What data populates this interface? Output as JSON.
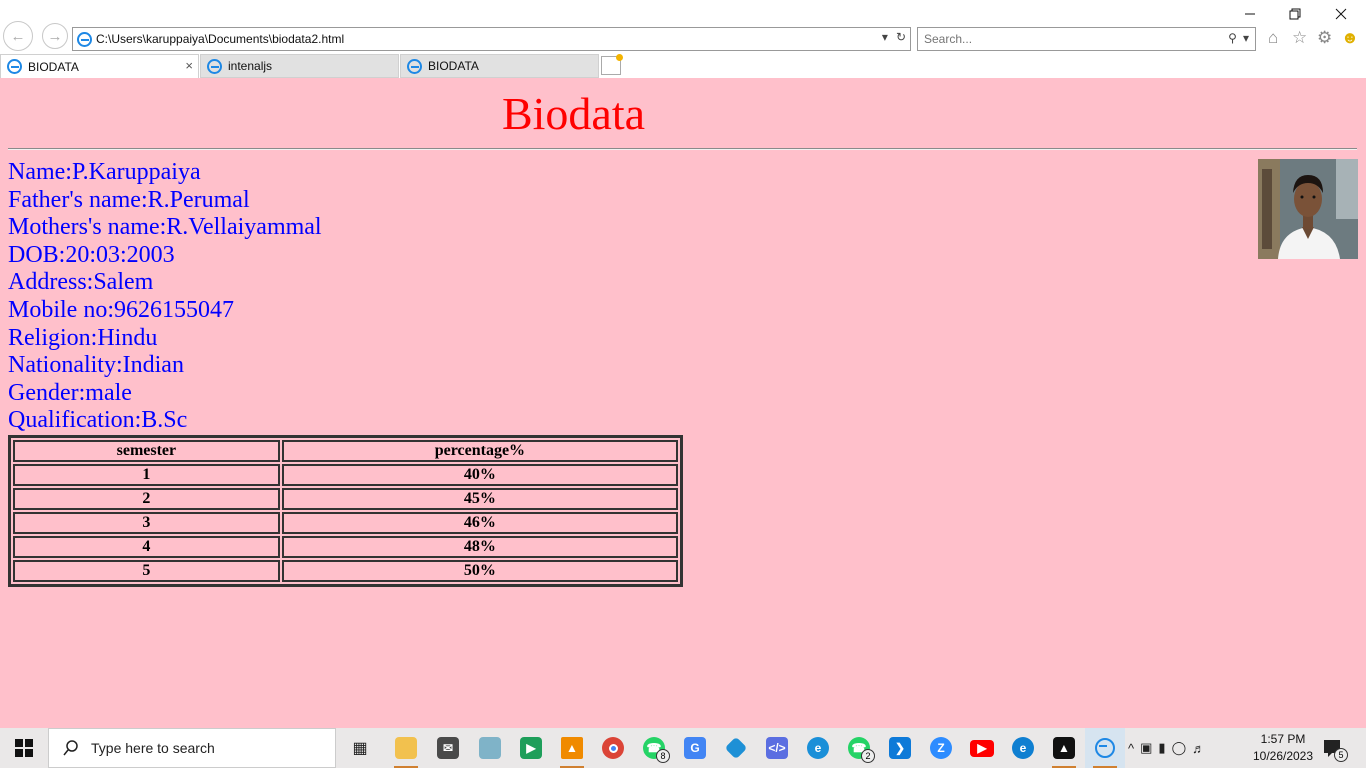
{
  "browser": {
    "address": "C:\\Users\\karuppaiya\\Documents\\biodata2.html",
    "search_placeholder": "Search...",
    "tabs": [
      {
        "label": "BIODATA",
        "active": true
      },
      {
        "label": "intenaljs",
        "active": false
      },
      {
        "label": "BIODATA",
        "active": false
      }
    ],
    "tab_close_glyph": "×"
  },
  "page": {
    "title": "Biodata",
    "details": [
      "Name:P.Karuppaiya",
      "Father's name:R.Perumal",
      "Mothers's name:R.Vellaiyammal",
      "DOB:20:03:2003",
      "Address:Salem",
      "Mobile no:9626155047",
      "Religion:Hindu",
      "Nationality:Indian",
      "Gender:male",
      "Qualification:B.Sc"
    ],
    "table": {
      "headers": [
        "semester",
        "percentage%"
      ],
      "rows": [
        [
          "1",
          "40%"
        ],
        [
          "2",
          "45%"
        ],
        [
          "3",
          "46%"
        ],
        [
          "4",
          "48%"
        ],
        [
          "5",
          "50%"
        ]
      ]
    },
    "colors": {
      "background": "#ffc0cb",
      "title": "#ff0000",
      "text": "#0000ff"
    }
  },
  "taskbar": {
    "search_placeholder": "Type here to search",
    "time": "1:57 PM",
    "date": "10/26/2023",
    "whatsapp_badge": "8",
    "whatsapp2_badge": "2",
    "notification_count": "5"
  }
}
